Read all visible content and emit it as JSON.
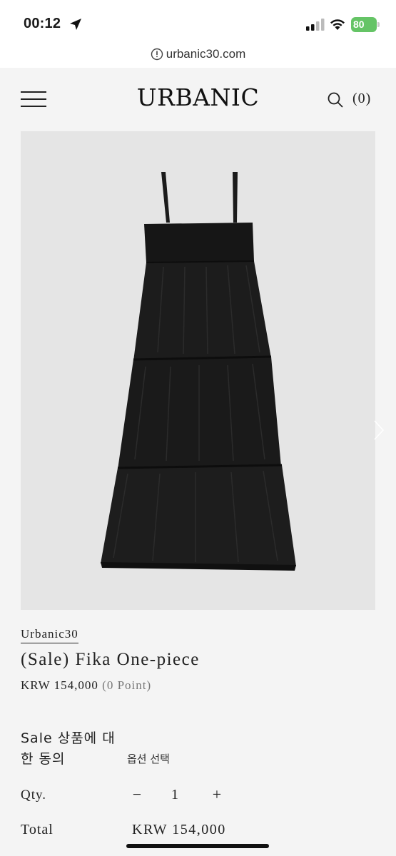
{
  "status_bar": {
    "time": "00:12",
    "battery": "80"
  },
  "browser": {
    "url": "urbanic30.com"
  },
  "header": {
    "logo": "URBANIC",
    "cart_count": "(0)"
  },
  "product": {
    "image_alt": "Black tiered sleeveless dress",
    "brand": "Urbanic30",
    "title": "(Sale) Fika One-piece",
    "price": "KRW 154,000",
    "points": "(0 Point)",
    "agreement_label": "Sale 상품에 대한 동의",
    "option_label": "옵션 선택",
    "qty_label": "Qty.",
    "qty_minus": "−",
    "qty_value": "1",
    "qty_plus": "+",
    "total_label": "Total",
    "total_value": "KRW 154,000"
  },
  "colors": {
    "page_background": "#f4f4f4",
    "image_background": "#e5e5e5",
    "battery_green": "#65c466",
    "text": "#222222"
  },
  "icons": [
    "location-arrow-icon",
    "signal-icon",
    "wifi-icon",
    "battery-icon",
    "info-icon",
    "hamburger-menu-icon",
    "search-icon",
    "chevron-right-icon"
  ]
}
